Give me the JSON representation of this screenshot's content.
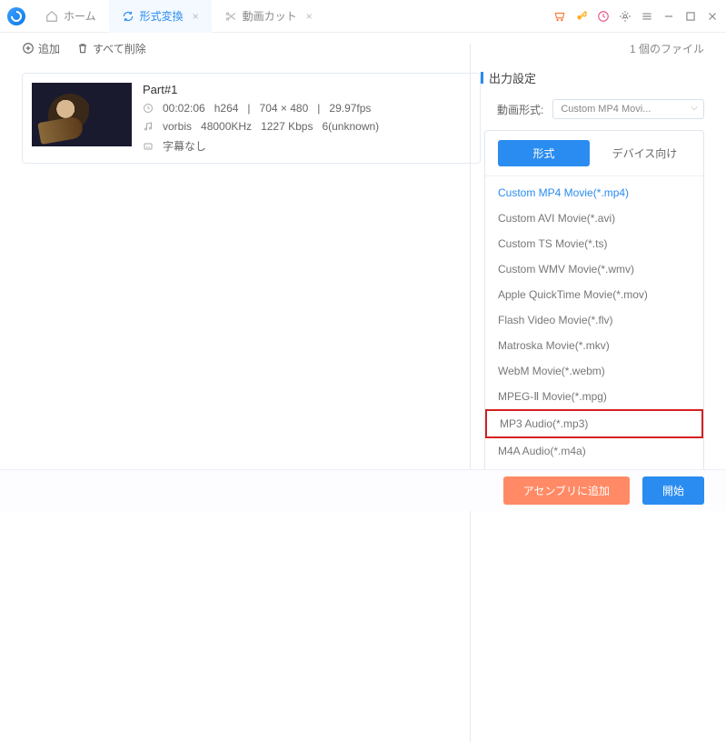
{
  "titlebar": {
    "tabs": [
      {
        "label": "ホーム",
        "icon": "home"
      },
      {
        "label": "形式変換",
        "icon": "refresh",
        "active": true
      },
      {
        "label": "動画カット",
        "icon": "scissors"
      }
    ],
    "right_icons": [
      "cart",
      "key",
      "history",
      "gear",
      "menu",
      "minimize",
      "maximize",
      "close"
    ]
  },
  "toolbar": {
    "add": "追加",
    "delete_all": "すべて削除",
    "file_count": "1 個のファイル"
  },
  "file": {
    "title": "Part#1",
    "duration": "00:02:06",
    "vcodec": "h264",
    "resolution": "704 × 480",
    "fps": "29.97fps",
    "acodec": "vorbis",
    "sample_rate": "48000KHz",
    "bitrate": "1227 Kbps",
    "channels": "6(unknown)",
    "subtitle": "字幕なし"
  },
  "side": {
    "title": "出力設定",
    "format_label": "動画形式:",
    "selected_format": "Custom MP4 Movi...",
    "dd_tabs": {
      "format": "形式",
      "device": "デバイス向け"
    },
    "formats": [
      "Custom MP4 Movie(*.mp4)",
      "Custom AVI Movie(*.avi)",
      "Custom TS Movie(*.ts)",
      "Custom WMV Movie(*.wmv)",
      "Apple QuickTime Movie(*.mov)",
      "Flash Video Movie(*.flv)",
      "Matroska Movie(*.mkv)",
      "WebM Movie(*.webm)",
      "MPEG-Ⅱ Movie(*.mpg)",
      "MP3 Audio(*.mp3)",
      "M4A Audio(*.m4a)"
    ],
    "highlight_index": 9,
    "selected_index": 0
  },
  "footer": {
    "add_assembly": "アセンブリに追加",
    "start": "開始"
  }
}
